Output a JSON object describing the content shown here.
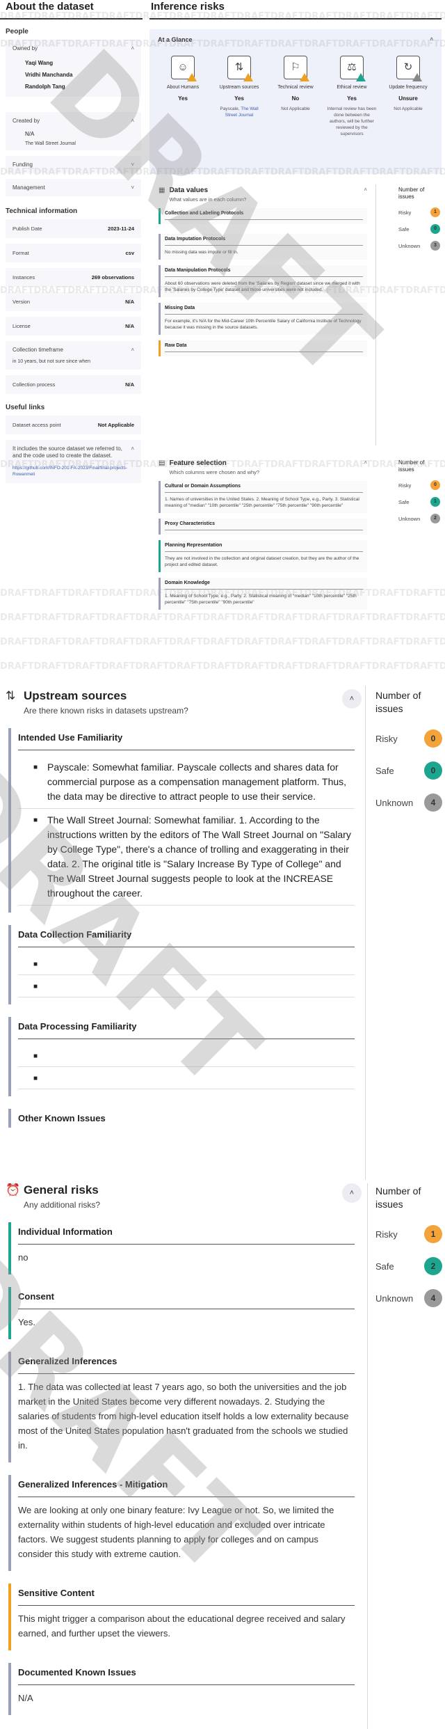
{
  "left": {
    "title": "About the dataset",
    "people_heading": "People",
    "owned_by_label": "Owned by",
    "owners": [
      "Yaqi Wang",
      "Vridhi Manchanda",
      "Randolph Tang"
    ],
    "created_by_label": "Created by",
    "created_by_value": "N/A",
    "created_by_sub": "The Wall Street Journal",
    "funding_label": "Funding",
    "management_label": "Management",
    "technical_heading": "Technical information",
    "tech": [
      {
        "k": "Publish Date",
        "v": "2023-11-24"
      },
      {
        "k": "Format",
        "v": "csv"
      },
      {
        "k": "Instances",
        "v": "269 observations"
      },
      {
        "k": "Version",
        "v": "N/A"
      },
      {
        "k": "License",
        "v": "N/A"
      }
    ],
    "collection_timeframe_label": "Collection timeframe",
    "collection_timeframe_value": "in 10 years, but not sure since when",
    "collection_process_label": "Collection process",
    "collection_process_value": "N/A",
    "useful_links_heading": "Useful links",
    "access_point_label": "Dataset access point",
    "access_point_value": "Not Applicable",
    "links_text": "It includes the source dataset we referred to, and the code used to create the dataset.",
    "links_url": "https://github.com/INFO-201-FA-2023/Final/final-projects-Rowanmeli"
  },
  "risks": {
    "title": "Inference risks",
    "glance_title": "At a Glance",
    "glance": [
      {
        "label": "About Humans",
        "value": "Yes",
        "note": "",
        "status": "warn",
        "icon": "person-icon"
      },
      {
        "label": "Upstream sources",
        "value": "Yes",
        "note_pre": "Payscale, ",
        "note_link": "The Wall Street Journal",
        "status": "warn",
        "icon": "upstream-icon"
      },
      {
        "label": "Technical review",
        "value": "No",
        "note": "Not Applicable",
        "status": "warn",
        "icon": "review-icon"
      },
      {
        "label": "Ethical review",
        "value": "Yes",
        "note": "Internal review has been done between the authors, will be further reviewed by the supervisors",
        "status": "ok",
        "icon": "scale-icon"
      },
      {
        "label": "Update frequency",
        "value": "Unsure",
        "note": "Not Applicable",
        "status": "grey",
        "icon": "refresh-icon"
      }
    ]
  },
  "data_values": {
    "title": "Data values",
    "subtitle": "What values are in each column?",
    "blocks": [
      {
        "title": "Collection and Labeling Protocols",
        "body": "",
        "color": "teal"
      },
      {
        "title": "Data Imputation Protocols",
        "body": "No missing data was impute or fill in.",
        "color": "grey"
      },
      {
        "title": "Data Manipulation Protocols",
        "body": "About 60 observations were deleted from the 'Salaries by Region' dataset since we merged it with the 'Salaries by College Type' dataset and those universities were not included.",
        "color": "grey"
      },
      {
        "title": "Missing Data",
        "body": "For example, it's N/A for the Mid-Career 10th Percentile Salary of California Institute of Technology because it was missing in the source datasets.",
        "color": "grey"
      },
      {
        "title": "Raw Data",
        "body": "",
        "color": "orange"
      }
    ],
    "issues_heading": "Number of issues",
    "risky_label": "Risky",
    "risky": "1",
    "safe_label": "Safe",
    "safe": "0",
    "unknown_label": "Unknown",
    "unknown": "3"
  },
  "feature_selection": {
    "title": "Feature selection",
    "subtitle": "Which columns were chosen and why?",
    "blocks": [
      {
        "title": "Cultural or Domain Assumptions",
        "body": "1. Names of universities in the United States. 2. Meaning of School Type, e.g., Party. 3. Statistical meaning of \"median\" \"10th percentile\" \"25th percentile\" \"75th percentile\" \"90th percentile\"",
        "color": "grey"
      },
      {
        "title": "Proxy Characteristics",
        "body": "",
        "color": "grey"
      },
      {
        "title": "Planning Representation",
        "body": "They are not involved in the collection and original dataset creation, but they are the author of the project and edited dataset.",
        "color": "teal"
      },
      {
        "title": "Domain Knowledge",
        "body": "1. Meaning of School Type, e.g., Party. 2. Statistical meaning of \"median\" \"10th percentile\" \"25th percentile\" \"75th percentile\" \"90th percentile\"",
        "color": "grey"
      }
    ],
    "issues_heading": "Number of issues",
    "risky_label": "Risky",
    "risky": "0",
    "safe_label": "Safe",
    "safe": "1",
    "unknown_label": "Unknown",
    "unknown": "2"
  },
  "upstream": {
    "title": "Upstream sources",
    "subtitle": "Are there known risks in datasets upstream?",
    "intended_title": "Intended Use Familiarity",
    "intended_bullets": [
      "Payscale: Somewhat familiar. Payscale collects and shares data for commercial purpose as a compensation management platform. Thus, the data may be directive to attract people to use their service.",
      "The Wall Street Journal: Somewhat familiar. 1. According to the instructions written by the editors of The Wall Street Journal on \"Salary by College Type\", there's a chance of trolling and exaggerating in their data. 2. The original title is \"Salary Increase By Type of College\" and The Wall Street Journal suggests people to look at the INCREASE throughout the career."
    ],
    "collection_title": "Data Collection Familiarity",
    "processing_title": "Data Processing Familiarity",
    "other_title": "Other Known Issues",
    "issues_heading": "Number of issues",
    "risky_label": "Risky",
    "risky": "0",
    "safe_label": "Safe",
    "safe": "0",
    "unknown_label": "Unknown",
    "unknown": "4"
  },
  "general": {
    "title": "General risks",
    "subtitle": "Any additional risks?",
    "blocks": [
      {
        "title": "Individual Information",
        "body": "no",
        "color": "teal"
      },
      {
        "title": "Consent",
        "body": "Yes.",
        "color": "teal"
      },
      {
        "title": "Generalized Inferences",
        "body": "1. The data was collected at least 7 years ago, so both the universities and the job market in the United States become very different nowadays. 2. Studying the salaries of students from high-level education itself holds a low externality because most of the United States population hasn't graduated from the schools we studied in.",
        "color": "grey"
      },
      {
        "title": "Generalized Inferences - Mitigation",
        "body": "We are looking at only one binary feature: Ivy League or not. So, we limited the externality within students of high-level education and excluded over intricate factors. We suggest students planning to apply for colleges and on campus consider this study with extreme caution.",
        "color": "grey"
      },
      {
        "title": "Sensitive Content",
        "body": "This might trigger a comparison about the educational degree received and salary earned, and further upset the viewers.",
        "color": "orange"
      },
      {
        "title": "Documented Known Issues",
        "body": "N/A",
        "color": "grey"
      }
    ],
    "issues_heading": "Number of issues",
    "risky_label": "Risky",
    "risky": "1",
    "safe_label": "Safe",
    "safe": "2",
    "unknown_label": "Unknown",
    "unknown": "4"
  },
  "watermark": "DRAFT",
  "watermark_strip": "DRAFTDRAFTDRAFTDRAFTDRAFTDRAFTDRAFTDRAFTDRAFTDRAFTDRAFTDRAFTDRAFTDRAFTDRAFT"
}
